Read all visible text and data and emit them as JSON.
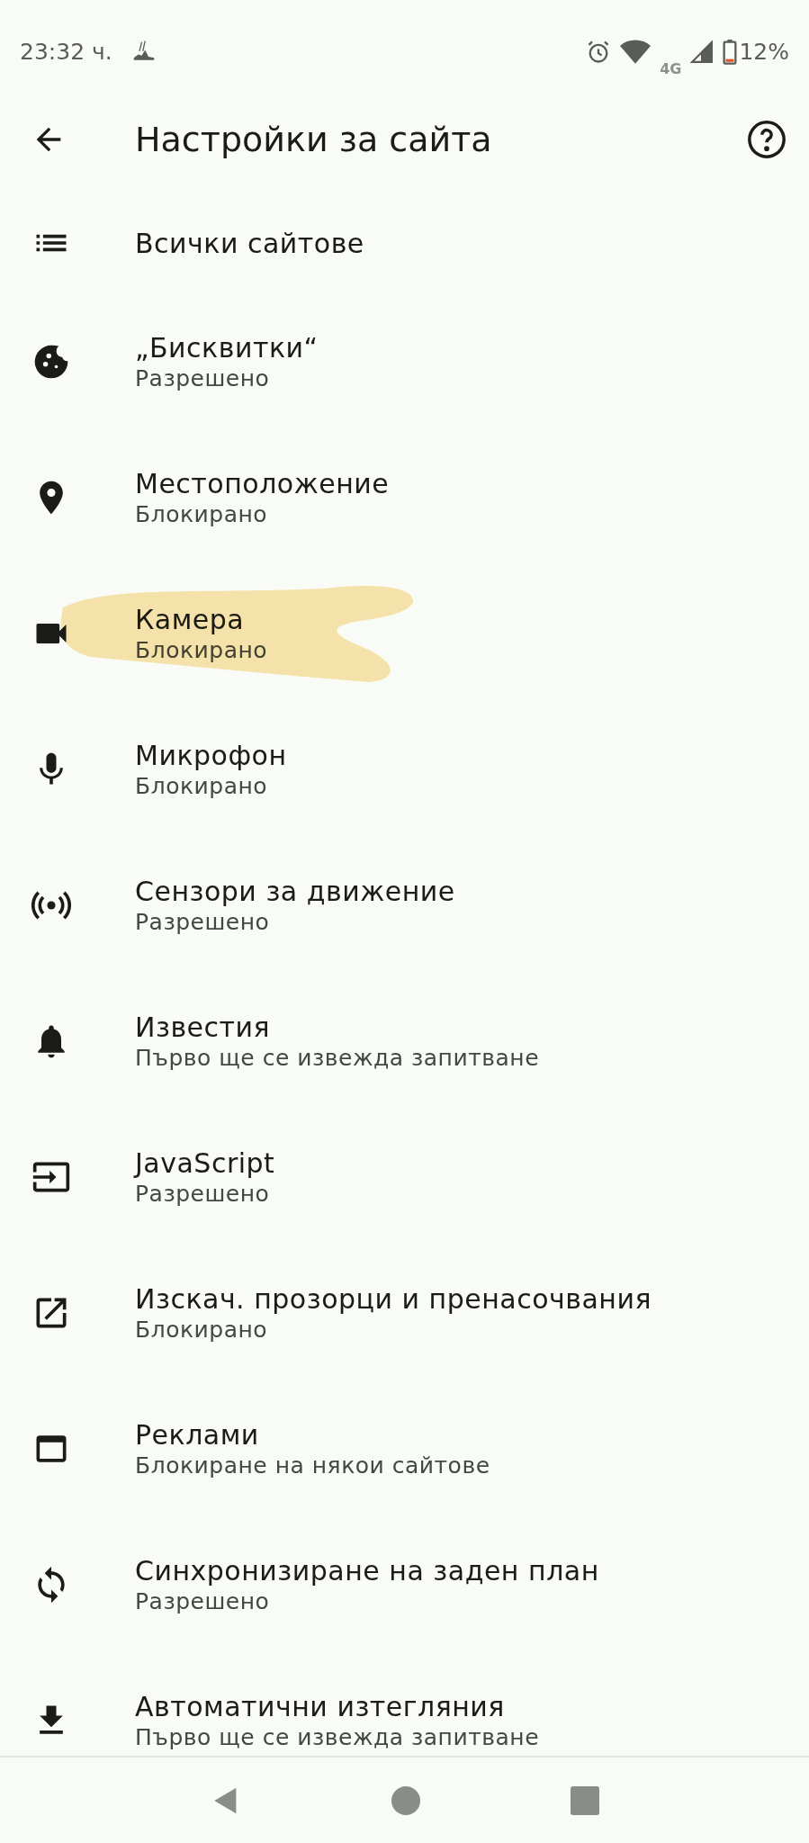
{
  "status_bar": {
    "time": "23:32 ч.",
    "network": "4G",
    "battery": "12%"
  },
  "app_bar": {
    "title": "Настройки за сайта"
  },
  "items": [
    {
      "title": "Всички сайтове",
      "highlighted": false
    },
    {
      "title": "„Бисквитки“",
      "subtitle": "Разрешено",
      "highlighted": false
    },
    {
      "title": "Местоположение",
      "subtitle": "Блокирано",
      "highlighted": false
    },
    {
      "title": "Камера",
      "subtitle": "Блокирано",
      "highlighted": true
    },
    {
      "title": "Микрофон",
      "subtitle": "Блокирано",
      "highlighted": false
    },
    {
      "title": "Сензори за движение",
      "subtitle": "Разрешено",
      "highlighted": false
    },
    {
      "title": "Известия",
      "subtitle": "Първо ще се извежда запитване",
      "highlighted": false
    },
    {
      "title": "JavaScript",
      "subtitle": "Разрешено",
      "highlighted": false
    },
    {
      "title": "Изскач. прозорци и пренасочвания",
      "subtitle": "Блокирано",
      "highlighted": false
    },
    {
      "title": "Реклами",
      "subtitle": "Блокиране на някои сайтове",
      "highlighted": false
    },
    {
      "title": "Синхронизиране на заден план",
      "subtitle": "Разрешено",
      "highlighted": false
    },
    {
      "title": "Автоматични изтегляния",
      "subtitle": "Първо ще се извежда запитване",
      "highlighted": false
    }
  ]
}
